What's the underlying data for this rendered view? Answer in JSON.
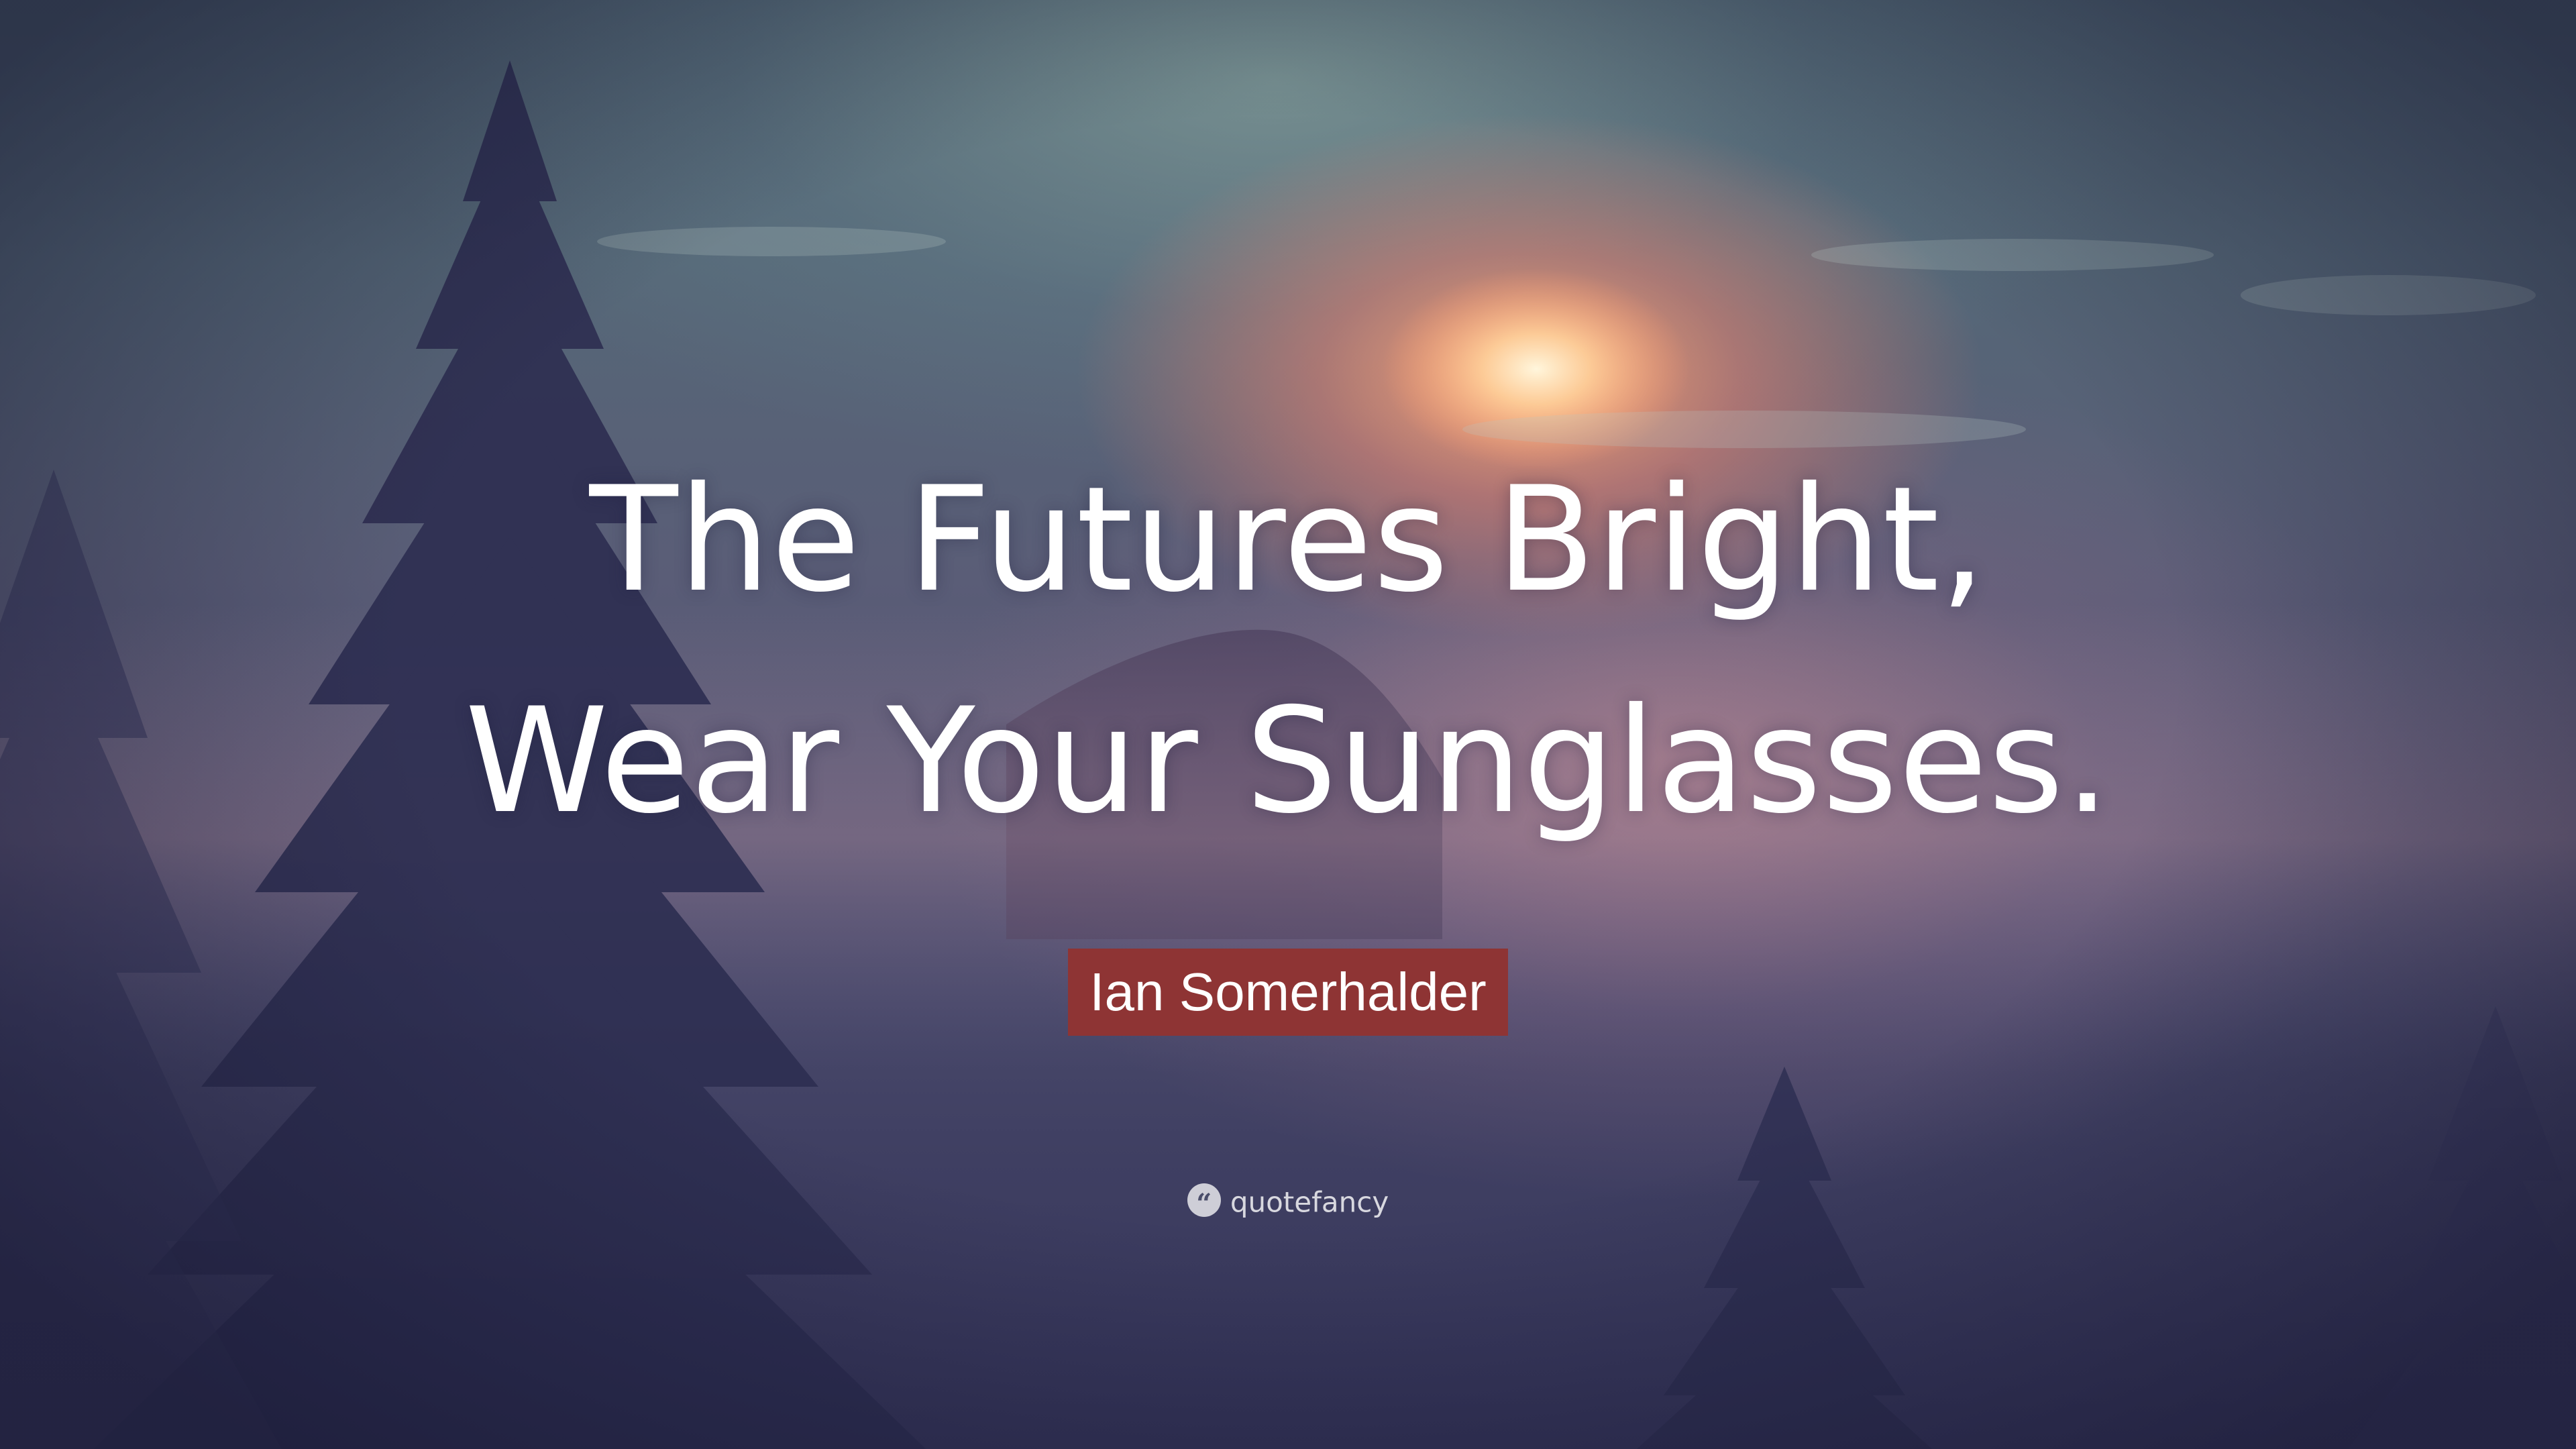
{
  "quote": {
    "lines": [
      "The Futures Bright,",
      "Wear Your Sunglasses."
    ]
  },
  "author": {
    "name": "Ian Somerhalder",
    "badge_color": "#8e3434"
  },
  "brand": {
    "icon": "quote-marks-icon",
    "icon_glyph": "“",
    "name": "quotefancy"
  },
  "colors": {
    "text": "#ffffff",
    "sun_glow": "#ffb27a",
    "tree_silhouette": "#2e2f52"
  }
}
